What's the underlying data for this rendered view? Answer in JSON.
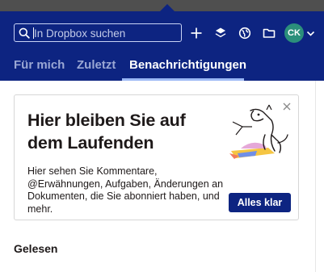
{
  "search": {
    "placeholder": "In Dropbox suchen"
  },
  "header": {
    "icons": [
      "plus-icon",
      "stack-icon",
      "globe-icon",
      "folder-icon"
    ],
    "avatar_initials": "CK",
    "avatar_color": "#2b8f7b",
    "brand_color": "#0d2481"
  },
  "tabs": [
    {
      "label": "Für mich",
      "active": false
    },
    {
      "label": "Zuletzt",
      "active": false
    },
    {
      "label": "Benachrichtigungen",
      "active": true
    }
  ],
  "card": {
    "title": "Hier bleiben Sie auf dem Laufenden",
    "body": "Hier sehen Sie Kommentare, @Erwähnungen, Aufgaben, Änderungen an Dokumenten, die Sie abonniert haben, und mehr.",
    "button_label": "Alles klar"
  },
  "section": {
    "title": "Gelesen"
  }
}
